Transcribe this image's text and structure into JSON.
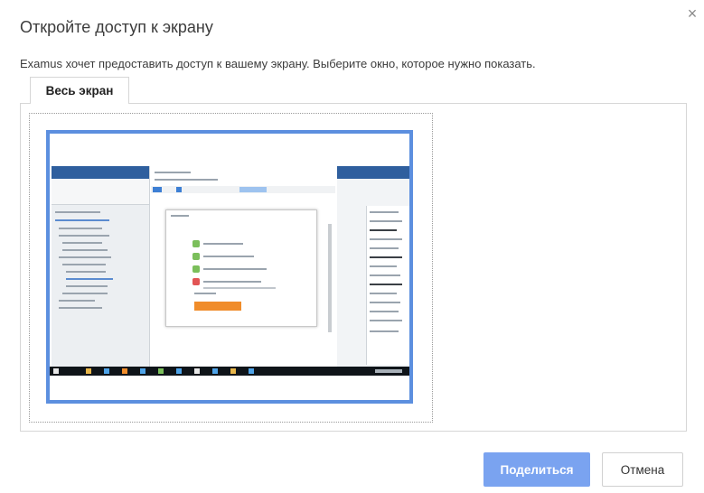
{
  "dialog": {
    "title": "Откройте доступ к экрану",
    "description": "Examus хочет предоставить доступ к вашему экрану. Выберите окно, которое нужно показать.",
    "close_symbol": "×"
  },
  "tabs": [
    {
      "label": "Весь экран",
      "active": true
    }
  ],
  "thumbnail": {
    "selected": true,
    "icon": "entire-screen-preview"
  },
  "buttons": {
    "share_label": "Поделиться",
    "cancel_label": "Отмена"
  },
  "colors": {
    "accent": "#5c8fdf",
    "share_button": "#7aa3f0",
    "preview_orange": "#f08c2a",
    "preview_taskbar": "#0f1419"
  }
}
